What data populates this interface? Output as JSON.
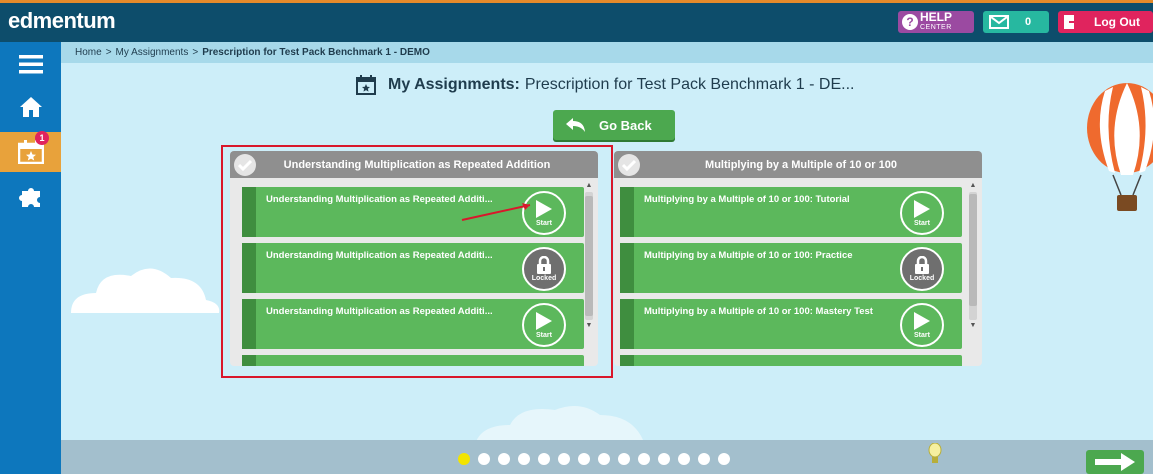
{
  "header": {
    "logo": "edmentum",
    "help": {
      "line1": "HELP",
      "line2": "CENTER"
    },
    "messages_count": "0",
    "logout_label": "Log Out"
  },
  "sidebar": {
    "items": [
      {
        "icon": "menu-icon"
      },
      {
        "icon": "home-icon"
      },
      {
        "icon": "assignments-calendar-icon",
        "badge": "1",
        "active": true
      },
      {
        "icon": "puzzle-icon"
      }
    ]
  },
  "breadcrumb": {
    "home": "Home",
    "parent": "My Assignments",
    "current": "Prescription for Test Pack Benchmark 1 - DEMO",
    "separator": ">"
  },
  "title": {
    "bold": "My Assignments:",
    "rest": "Prescription for Test Pack Benchmark 1 - DE..."
  },
  "go_back_label": "Go Back",
  "panels": [
    {
      "title": "Understanding Multiplication as Repeated Addition",
      "activities": [
        {
          "label": "Understanding Multiplication as Repeated Additi...",
          "status": "Start"
        },
        {
          "label": "Understanding Multiplication as Repeated Additi...",
          "status": "Locked"
        },
        {
          "label": "Understanding Multiplication as Repeated Additi...",
          "status": "Start"
        }
      ]
    },
    {
      "title": "Multiplying by a Multiple of 10 or 100",
      "activities": [
        {
          "label": "Multiplying by a Multiple of 10 or 100: Tutorial",
          "status": "Start"
        },
        {
          "label": "Multiplying by a Multiple of 10 or 100: Practice",
          "status": "Locked"
        },
        {
          "label": "Multiplying by a Multiple of 10 or 100: Mastery Test",
          "status": "Start"
        }
      ]
    }
  ],
  "pagination": {
    "total_dots": 14,
    "active_index": 0
  },
  "colors": {
    "topbar": "#0d4d6b",
    "sidebar": "#0d77bd",
    "activity_green": "#5cb85c",
    "locked_gray": "#6f6f6f",
    "highlight_red": "#d9172b",
    "active_dot": "#f3e400"
  }
}
